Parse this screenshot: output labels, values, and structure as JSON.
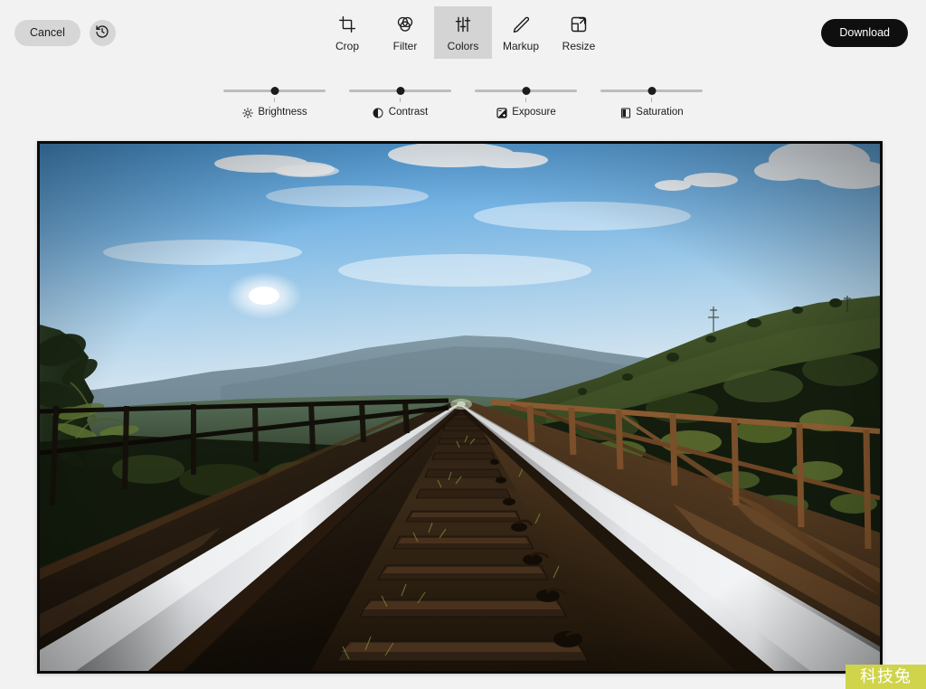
{
  "topbar": {
    "cancel_label": "Cancel",
    "history_icon": "history-restore-icon",
    "download_label": "Download"
  },
  "tools": {
    "active": "Colors",
    "tabs": [
      {
        "label": "Crop",
        "icon": "crop-icon",
        "active": false
      },
      {
        "label": "Filter",
        "icon": "filter-icon",
        "active": false
      },
      {
        "label": "Colors",
        "icon": "sliders-icon",
        "active": true
      },
      {
        "label": "Markup",
        "icon": "pencil-icon",
        "active": false
      },
      {
        "label": "Resize",
        "icon": "resize-icon",
        "active": false
      }
    ]
  },
  "adjustments": {
    "sliders": [
      {
        "label": "Brightness",
        "icon": "brightness-sun-icon",
        "value": 50,
        "min": 0,
        "max": 100
      },
      {
        "label": "Contrast",
        "icon": "contrast-circle-icon",
        "value": 50,
        "min": 0,
        "max": 100
      },
      {
        "label": "Exposure",
        "icon": "exposure-square-icon",
        "value": 50,
        "min": 0,
        "max": 100
      },
      {
        "label": "Saturation",
        "icon": "saturation-box-icon",
        "value": 50,
        "min": 0,
        "max": 100
      }
    ]
  },
  "canvas": {
    "image_alt": "Railway track on a bridge leading toward green hills under a blue sky"
  },
  "watermark": {
    "text": "科技兔",
    "background": "#cfd44a",
    "color": "#ffffff"
  },
  "theme": {
    "page_background": "#f2f2f2",
    "accent_dark": "#0f0f0f",
    "button_grey": "#d6d6d6",
    "active_tab_grey": "#d4d4d4"
  }
}
